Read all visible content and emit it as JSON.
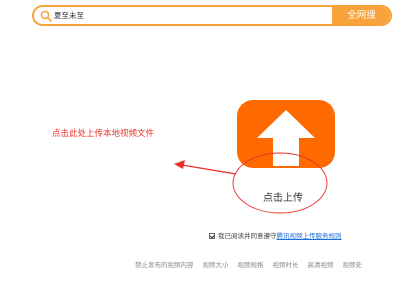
{
  "search": {
    "value": "夏至未至",
    "button_label": "全网搜"
  },
  "colors": {
    "accent": "#f7a23a",
    "upload": "#ff6a00",
    "annotation": "#e8322a",
    "link": "#1a6ed8"
  },
  "icons": {
    "search": "search-icon",
    "chart": "bar-chart-icon",
    "upload": "upload-arrow-icon"
  },
  "annotation": {
    "hint": "点击此处上传本地视频文件"
  },
  "upload": {
    "label": "点击上传"
  },
  "agreement": {
    "checked": true,
    "text": "我已阅读并同意遵守",
    "link": "腾讯视频上传服务规则"
  },
  "footer": {
    "links": [
      "禁止发布的视频内容",
      "视频大小",
      "视频规格",
      "视频时长",
      "高清视频",
      "视频处"
    ]
  }
}
